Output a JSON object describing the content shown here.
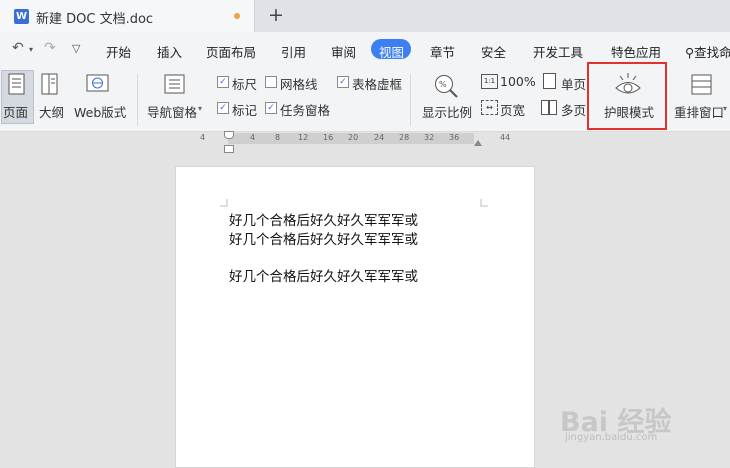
{
  "tab": {
    "icon_letter": "W",
    "title": "新建 DOC 文档.doc",
    "new_tab": "+"
  },
  "quick": {
    "undo": "↶",
    "redo": "↷",
    "more": "▽"
  },
  "menu": {
    "start": "开始",
    "insert": "插入",
    "layout": "页面布局",
    "reference": "引用",
    "review": "审阅",
    "view": "视图",
    "chapter": "章节",
    "security": "安全",
    "devtools": "开发工具",
    "features": "特色应用",
    "search": "查找命"
  },
  "ribbon": {
    "page": "页面",
    "outline": "大纲",
    "web": "Web版式",
    "nav": "导航窗格",
    "ruler": "标尺",
    "gridlines": "网格线",
    "table_frame": "表格虚框",
    "marks": "标记",
    "task_pane": "任务窗格",
    "zoom": "显示比例",
    "zoom100": "100%",
    "page_width": "页宽",
    "single_page": "单页",
    "multi_page": "多页",
    "eye_mode": "护眼模式",
    "rearrange": "重排窗口"
  },
  "ruler_ticks": [
    "4",
    "4",
    "8",
    "12",
    "16",
    "20",
    "24",
    "28",
    "32",
    "36",
    "44"
  ],
  "document": {
    "lines": [
      "好几个合格后好久好久军军军或",
      "好几个合格后好久好久军军军或",
      "好几个合格后好久好久军军军或"
    ]
  },
  "watermark": {
    "main": "Bai 经验",
    "sub": "jingyan.baidu.com"
  },
  "colors": {
    "accent": "#3d7ff2",
    "highlight": "#e0332e"
  }
}
